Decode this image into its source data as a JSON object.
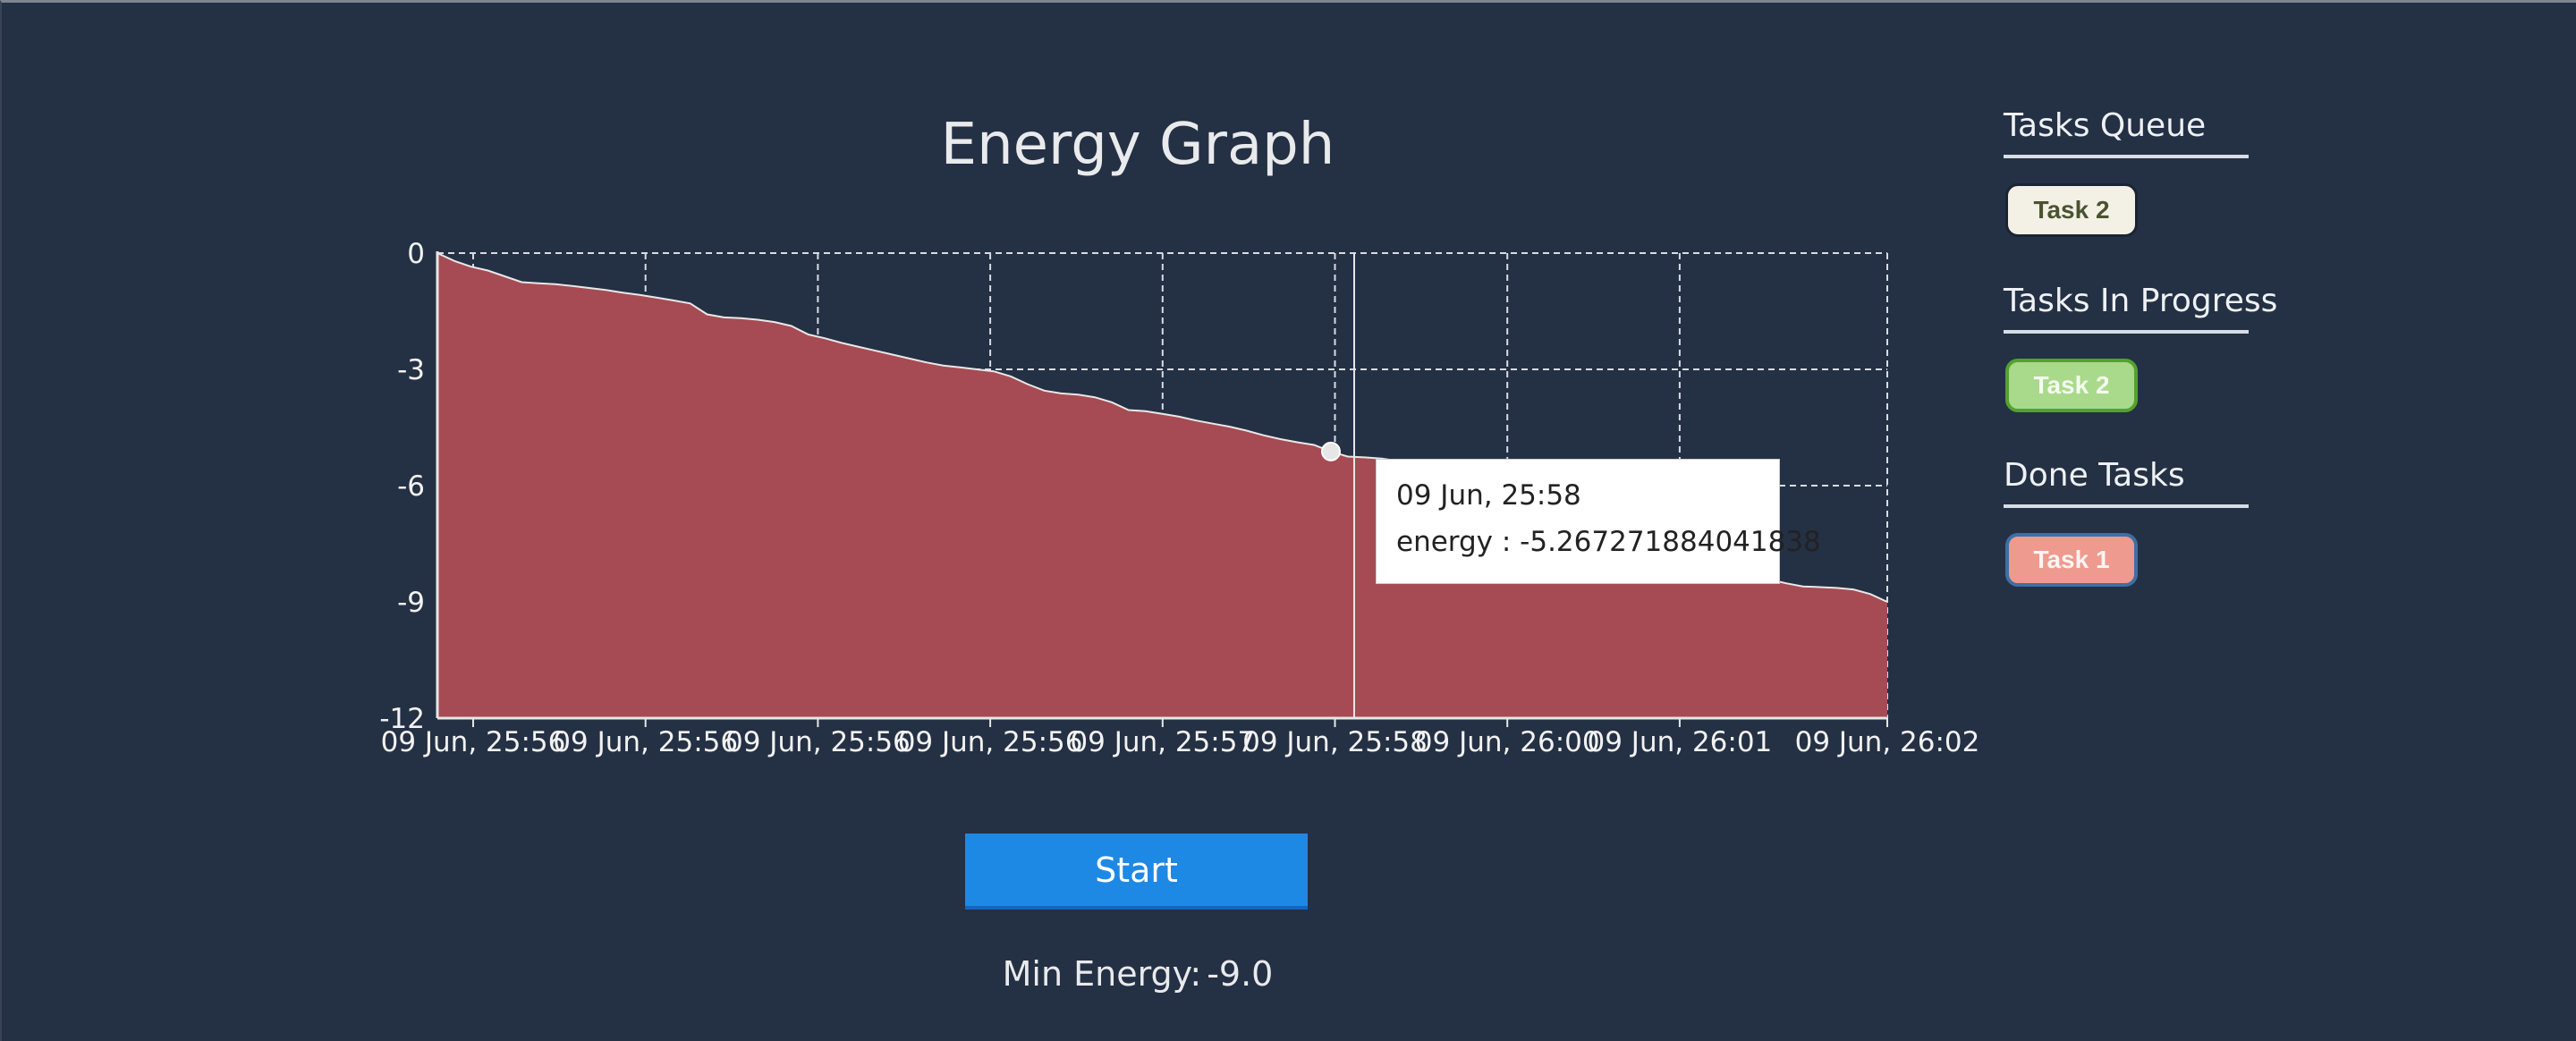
{
  "title": "Energy Graph",
  "chart_data": {
    "type": "area",
    "ylim": [
      -12,
      0
    ],
    "yticks": [
      0,
      -3,
      -6,
      -9,
      -12
    ],
    "xtick_labels": [
      "09 Jun, 25:56",
      "09 Jun, 25:56",
      "09 Jun, 25:56",
      "09 Jun, 25:56",
      "09 Jun, 25:57",
      "09 Jun, 25:58",
      "09 Jun, 26:00",
      "09 Jun, 26:01",
      "09 Jun, 26:02"
    ],
    "x_index_range": [
      0,
      86
    ],
    "x": [
      0,
      1,
      2,
      3,
      4,
      5,
      6,
      7,
      8,
      9,
      10,
      11,
      12,
      13,
      14,
      15,
      16,
      17,
      18,
      19,
      20,
      21,
      22,
      23,
      24,
      25,
      26,
      27,
      28,
      29,
      30,
      31,
      32,
      33,
      34,
      35,
      36,
      37,
      38,
      39,
      40,
      41,
      42,
      43,
      44,
      45,
      46,
      47,
      48,
      49,
      50,
      51,
      52,
      53,
      54,
      55,
      56,
      57,
      58,
      59,
      60,
      61,
      62,
      63,
      64,
      65,
      66,
      67,
      68,
      69,
      70,
      71,
      72,
      73,
      74,
      75,
      76,
      77,
      78,
      79,
      80,
      81,
      82,
      83,
      84,
      85,
      86
    ],
    "series": [
      {
        "values": [
          0.0,
          -0.2,
          -0.35,
          -0.45,
          -0.6,
          -0.75,
          -0.78,
          -0.8,
          -0.85,
          -0.9,
          -0.95,
          -1.02,
          -1.08,
          -1.15,
          -1.22,
          -1.3,
          -1.58,
          -1.66,
          -1.68,
          -1.72,
          -1.78,
          -1.88,
          -2.1,
          -2.2,
          -2.32,
          -2.42,
          -2.52,
          -2.62,
          -2.72,
          -2.82,
          -2.9,
          -2.95,
          -3.0,
          -3.05,
          -3.18,
          -3.38,
          -3.55,
          -3.62,
          -3.65,
          -3.72,
          -3.85,
          -4.05,
          -4.08,
          -4.15,
          -4.22,
          -4.32,
          -4.4,
          -4.48,
          -4.58,
          -4.7,
          -4.8,
          -4.88,
          -4.95,
          -5.12,
          -5.25,
          -5.27,
          -5.3,
          -5.36,
          -5.45,
          -5.55,
          -5.68,
          -5.85,
          -6.0,
          -6.1,
          -6.22,
          -6.36,
          -6.5,
          -6.68,
          -6.82,
          -6.96,
          -7.1,
          -7.22,
          -7.4,
          -7.56,
          -7.72,
          -7.88,
          -8.02,
          -8.15,
          -8.28,
          -8.42,
          -8.52,
          -8.6,
          -8.62,
          -8.64,
          -8.68,
          -8.8,
          -9.0
        ],
        "color": "#a64b53",
        "line_color": "#e8e8e8"
      }
    ],
    "grid": true,
    "tooltip": {
      "point_index": 53,
      "date_label": "09 Jun, 25:58",
      "value_label": "energy : -5.267271884041838"
    }
  },
  "controls": {
    "start_label": "Start",
    "min_energy_label": "Min Energy:",
    "min_energy_value": "-9.0"
  },
  "sidebar": {
    "queue": {
      "heading": "Tasks Queue",
      "tasks": [
        "Task 2"
      ]
    },
    "in_progress": {
      "heading": "Tasks In Progress",
      "tasks": [
        "Task 2"
      ]
    },
    "done": {
      "heading": "Done Tasks",
      "tasks": [
        "Task 1"
      ]
    }
  },
  "colors": {
    "background": "#243044",
    "accent": "#1e88e5",
    "area_fill": "#a64b53"
  }
}
